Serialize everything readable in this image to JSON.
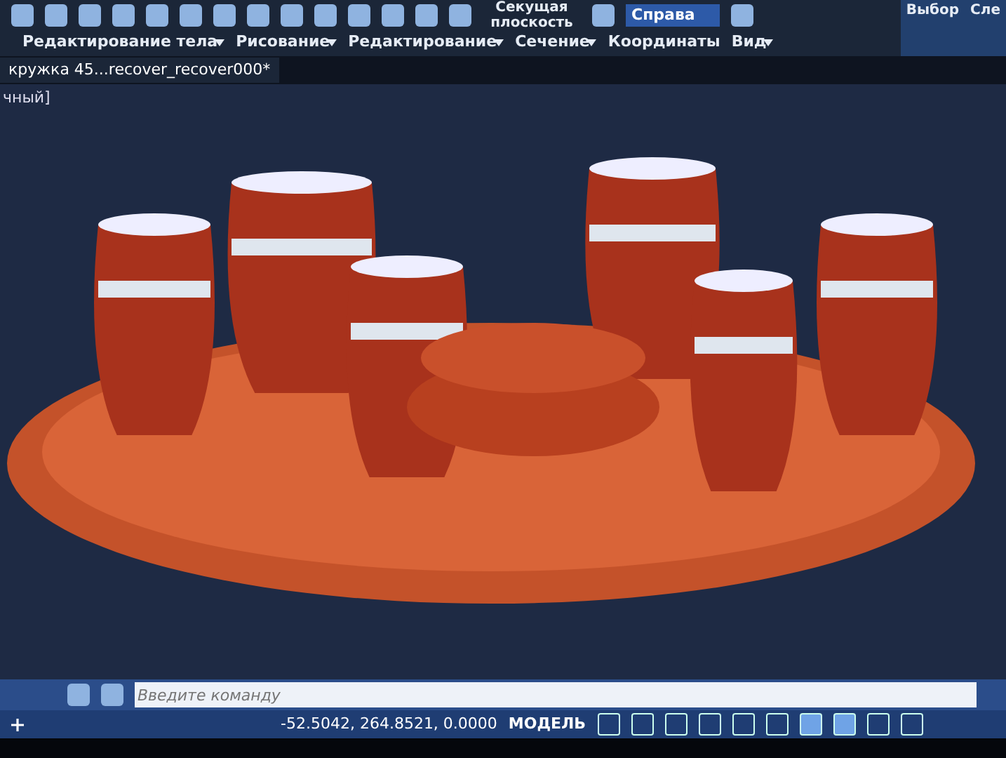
{
  "ribbon": {
    "section_plane": "Секущая плоскость",
    "view_dropdown": "Справа",
    "right_panels": [
      "Выбор",
      "Сле"
    ],
    "panels": [
      {
        "label": "Редактирование тела",
        "dropdown": true
      },
      {
        "label": "Рисование",
        "dropdown": true
      },
      {
        "label": "Редактирование",
        "dropdown": true
      },
      {
        "label": "Сечение",
        "dropdown": true
      },
      {
        "label": "Координаты",
        "dropdown": false
      },
      {
        "label": "Вид",
        "dropdown": true
      }
    ]
  },
  "file_tabs": [
    {
      "label": "кружка 45...recover_recover000*",
      "selected": true
    }
  ],
  "viewport": {
    "label": "чный]"
  },
  "command_line": {
    "placeholder": "Введите команду"
  },
  "status_bar": {
    "coordinates": "-52.5042, 264.8521, 0.0000",
    "space": "МОДЕЛЬ",
    "toggles": [
      {
        "on": false
      },
      {
        "on": false
      },
      {
        "on": false
      },
      {
        "on": false
      },
      {
        "on": false
      },
      {
        "on": false
      },
      {
        "on": true
      },
      {
        "on": true
      },
      {
        "on": false
      },
      {
        "on": false
      }
    ]
  }
}
